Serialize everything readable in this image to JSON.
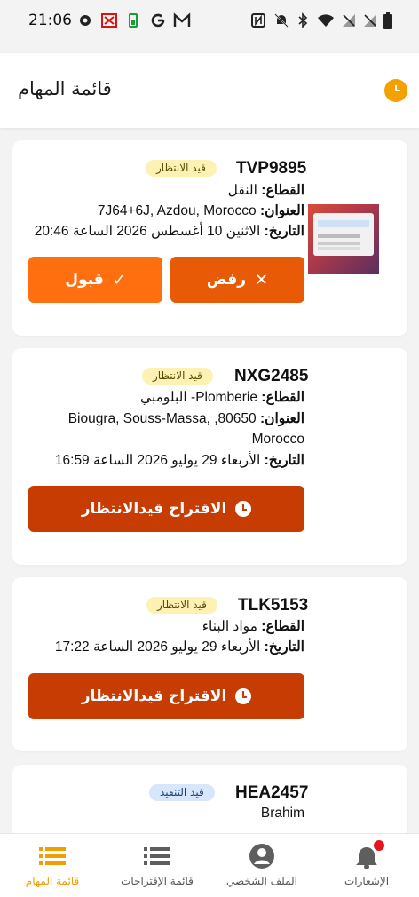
{
  "status_bar": {
    "time": "21:06",
    "icons": [
      "gear-icon",
      "scissors-icon",
      "battery-saver-icon",
      "google-icon",
      "gmail-icon",
      "nfc-icon",
      "bell-off-icon",
      "bluetooth-icon",
      "wifi-icon",
      "signal-off-icon",
      "signal-off-icon",
      "battery-icon"
    ]
  },
  "header": {
    "title": "قائمة المهام",
    "status_icon": "clock-icon",
    "accent_color": "#f4a100"
  },
  "tasks": [
    {
      "code": "TVP9895",
      "status": "قيد الانتظار",
      "sector_label": "القطاع:",
      "sector": "النقل",
      "address_label": "العنوان:",
      "address": "7J64+6J, Azdou, Morocco",
      "date_label": "التاريخ:",
      "date": "الاثنين 10 أغسطس 2026 الساعة 20:46",
      "buttons": {
        "accept": "قبول",
        "reject": "رفض"
      }
    },
    {
      "code": "NXG2485",
      "status": "قيد الانتظار",
      "sector_label": "القطاع:",
      "sector": "Plomberie- البلومبي",
      "address_label": "العنوان:",
      "address_line1": "Biougra, Souss-Massa, ,80650",
      "address_line2": "Morocco",
      "date_label": "التاريخ:",
      "date": "الأربعاء 29 يوليو 2026 الساعة 16:59",
      "button": "الاقتراح قيدالانتظار"
    },
    {
      "code": "TLK5153",
      "status": "قيد الانتظار",
      "sector_label": "القطاع:",
      "sector": "مواد البناء",
      "date_label": "التاريخ:",
      "date": "الأربعاء 29 يوليو 2026 الساعة 17:22",
      "button": "الاقتراح قيدالانتظار"
    },
    {
      "code": "HEA2457",
      "status": "قيد التنفيذ",
      "client": "Brahim"
    }
  ],
  "bottom_nav": [
    {
      "label": "قائمة المهام",
      "icon": "list-icon",
      "active": true
    },
    {
      "label": "قائمة الإقتراحات",
      "icon": "list-icon",
      "active": false
    },
    {
      "label": "الملف الشخصي",
      "icon": "account-icon",
      "active": false
    },
    {
      "label": "الإشعارات",
      "icon": "bell-icon",
      "active": false
    }
  ],
  "colors": {
    "accept": "#ff6f0f",
    "reject": "#e85a05",
    "propose": "#c63c03",
    "active_nav": "#f29d00"
  }
}
